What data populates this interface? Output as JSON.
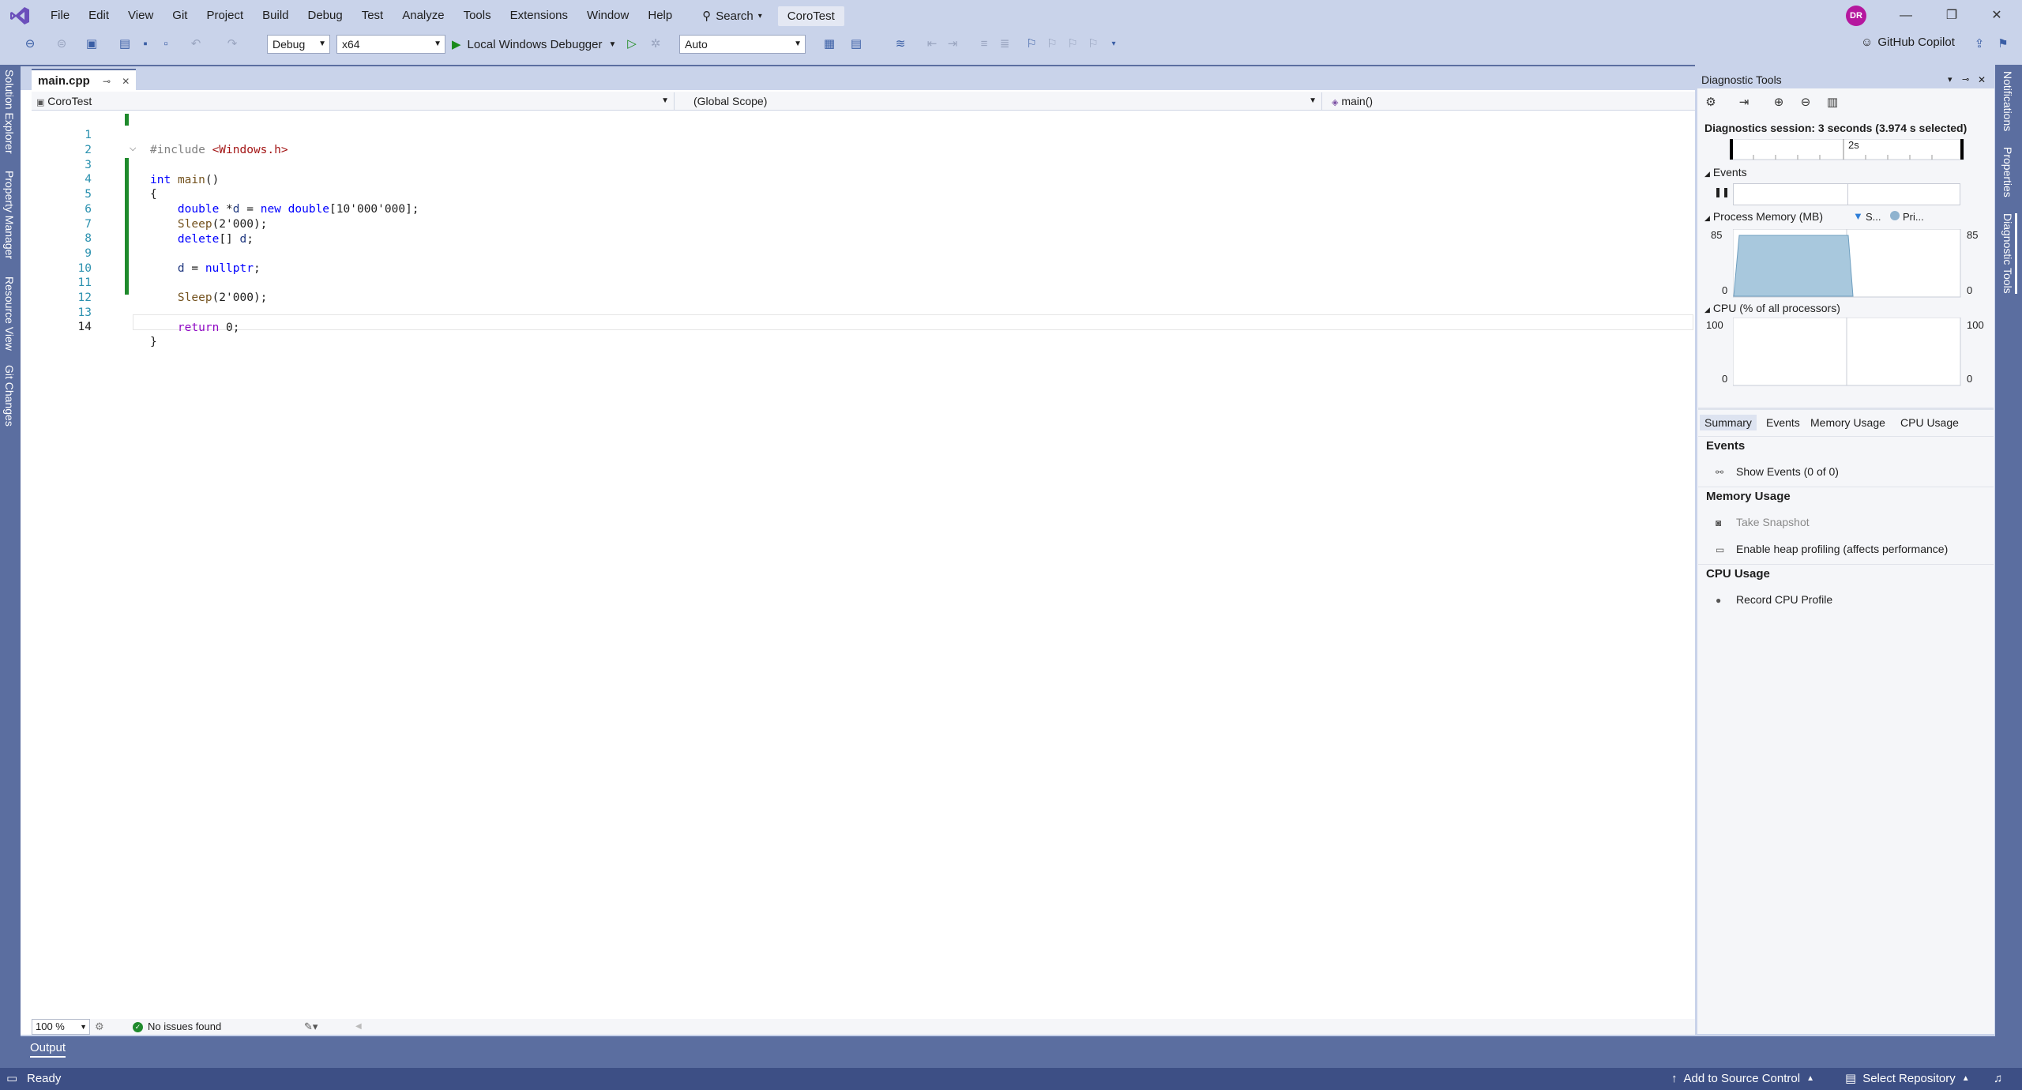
{
  "title_bar": {
    "menu": [
      "File",
      "Edit",
      "View",
      "Git",
      "Project",
      "Build",
      "Debug",
      "Test",
      "Analyze",
      "Tools",
      "Extensions",
      "Window",
      "Help"
    ],
    "search_label": "Search",
    "solution_name": "CoroTest",
    "avatar_initials": "DR"
  },
  "toolbar": {
    "config": "Debug",
    "platform": "x64",
    "debugger_label": "Local Windows Debugger",
    "frame_combo": "Auto",
    "copilot_label": "GitHub Copilot"
  },
  "left_strip": [
    "Solution Explorer",
    "Property Manager",
    "Resource View",
    "Git Changes"
  ],
  "right_strip": [
    "Notifications",
    "Properties",
    "Diagnostic Tools"
  ],
  "editor": {
    "tab_label": "main.cpp",
    "nav_project": "CoroTest",
    "nav_scope": "(Global Scope)",
    "nav_member": "main()",
    "zoom": "100 %",
    "issues": "No issues found",
    "lines": [
      "1",
      "2",
      "3",
      "4",
      "5",
      "6",
      "7",
      "8",
      "9",
      "10",
      "11",
      "12",
      "13",
      "14"
    ]
  },
  "diagnostics": {
    "title": "Diagnostic Tools",
    "session": "Diagnostics session: 3 seconds (3.974 s selected)",
    "timeline_tick": "2s",
    "events_label": "Events",
    "memory_label": "Process Memory (MB)",
    "memory_legend_snapshot": "S...",
    "memory_legend_private": "Pri...",
    "memory_max": "85",
    "memory_min": "0",
    "cpu_label": "CPU (% of all processors)",
    "cpu_max": "100",
    "cpu_min": "0",
    "tabs": [
      "Summary",
      "Events",
      "Memory Usage",
      "CPU Usage"
    ],
    "summary": {
      "events_header": "Events",
      "show_events": "Show Events (0 of 0)",
      "memory_header": "Memory Usage",
      "take_snapshot": "Take Snapshot",
      "heap_profiling": "Enable heap profiling (affects performance)",
      "cpu_header": "CPU Usage",
      "record_cpu": "Record CPU Profile"
    }
  },
  "output_tab": "Output",
  "status_bar": {
    "ready": "Ready",
    "source_control": "Add to Source Control",
    "repository": "Select Repository"
  }
}
